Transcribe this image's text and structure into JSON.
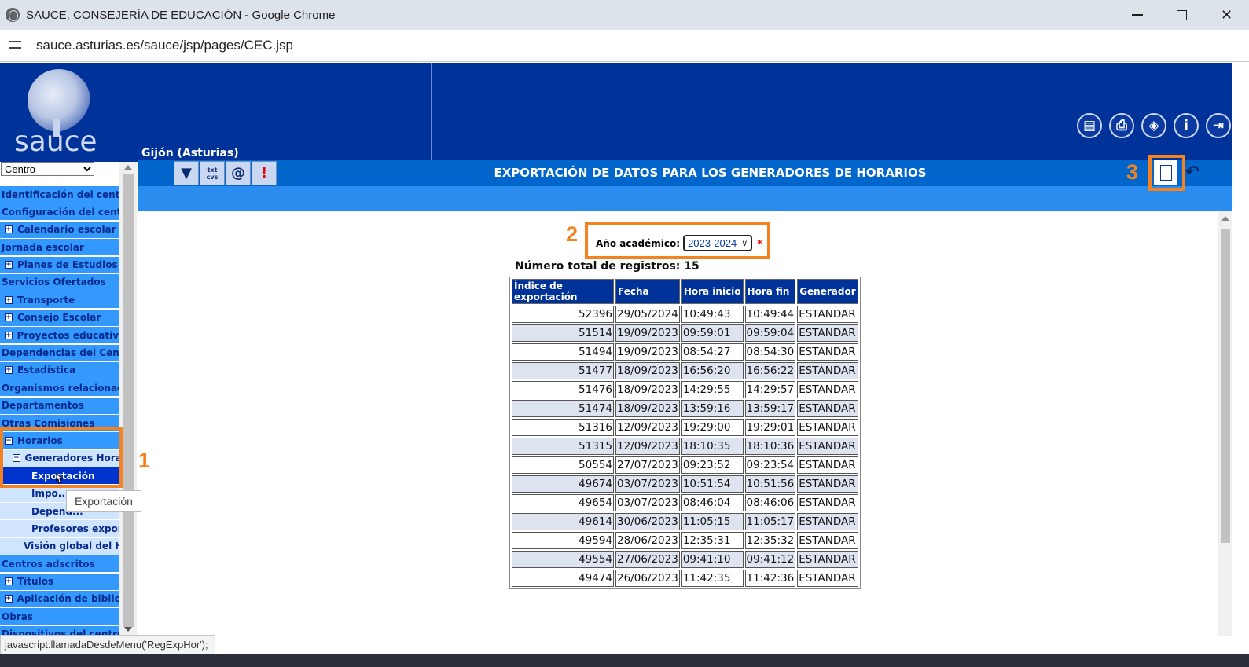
{
  "browser": {
    "title": "SAUCE, CONSEJERÍA DE EDUCACIÓN - Google Chrome",
    "url": "sauce.asturias.es/sauce/jsp/pages/CEC.jsp",
    "minimize": "",
    "maximize": "",
    "close": "✕",
    "status": "javascript:llamadaDesdeMenu('RegExpHor');"
  },
  "header": {
    "logo_text": "sauce",
    "location": "Gijón (Asturias)",
    "tools": [
      "manual-icon",
      "print-icon",
      "navigate-icon",
      "info-icon",
      "exit-icon"
    ],
    "info_glyph": "i"
  },
  "sidebar": {
    "selector_value": "Centro",
    "items": [
      {
        "label": "Identificación del centro",
        "type": "top"
      },
      {
        "label": "Configuración del centro",
        "type": "top"
      },
      {
        "label": "Calendario escolar",
        "type": "expand"
      },
      {
        "label": "Jornada escolar",
        "type": "top"
      },
      {
        "label": "Planes de Estudios",
        "type": "expand"
      },
      {
        "label": "Servicios Ofertados",
        "type": "top"
      },
      {
        "label": "Transporte",
        "type": "expand"
      },
      {
        "label": "Consejo Escolar",
        "type": "expand"
      },
      {
        "label": "Proyectos educativos",
        "type": "expand"
      },
      {
        "label": "Dependencias del Centro",
        "type": "top"
      },
      {
        "label": "Estadística",
        "type": "expand"
      },
      {
        "label": "Organismos relacionados",
        "type": "top"
      },
      {
        "label": "Departamentos",
        "type": "top"
      },
      {
        "label": "Otras Comisiones",
        "type": "top"
      },
      {
        "label": "Horarios",
        "type": "collapse"
      },
      {
        "label": "Generadores Horarios",
        "type": "collapse-sub"
      },
      {
        "label": "Exportación",
        "type": "active"
      },
      {
        "label": "Impo...",
        "type": "leaf"
      },
      {
        "label": "Depend...",
        "type": "leaf"
      },
      {
        "label": "Profesores exportados",
        "type": "leaf"
      },
      {
        "label": "Visión global del Horario",
        "type": "leaf2"
      },
      {
        "label": "Centros adscritos",
        "type": "top"
      },
      {
        "label": "Títulos",
        "type": "expand"
      },
      {
        "label": "Aplicación de bibliotecas",
        "type": "expand"
      },
      {
        "label": "Obras",
        "type": "top"
      },
      {
        "label": "Dispositivos del centro",
        "type": "top"
      }
    ],
    "tooltip": "Exportación"
  },
  "toolbar": {
    "page_title": "EXPORTACIÓN DE DATOS PARA LOS GENERADORES DE HORARIOS",
    "left_buttons": [
      "filter-icon",
      "export-txt-csv-icon",
      "email-icon",
      "alert-icon"
    ],
    "txt_label": "txt",
    "csv_label": "cvs",
    "right_buttons": [
      "new-document-icon",
      "back-icon"
    ]
  },
  "form": {
    "year_label": "Año académico:",
    "year_value": "2023-2024",
    "required_mark": "*"
  },
  "summary": {
    "label": "Número total de registros:",
    "count": "15"
  },
  "table": {
    "headers": [
      "Índice de exportación",
      "Fecha",
      "Hora inicio",
      "Hora fin",
      "Generador"
    ],
    "rows": [
      [
        "52396",
        "29/05/2024",
        "10:49:43",
        "10:49:44",
        "ESTANDAR"
      ],
      [
        "51514",
        "19/09/2023",
        "09:59:01",
        "09:59:04",
        "ESTANDAR"
      ],
      [
        "51494",
        "19/09/2023",
        "08:54:27",
        "08:54:30",
        "ESTANDAR"
      ],
      [
        "51477",
        "18/09/2023",
        "16:56:20",
        "16:56:22",
        "ESTANDAR"
      ],
      [
        "51476",
        "18/09/2023",
        "14:29:55",
        "14:29:57",
        "ESTANDAR"
      ],
      [
        "51474",
        "18/09/2023",
        "13:59:16",
        "13:59:17",
        "ESTANDAR"
      ],
      [
        "51316",
        "12/09/2023",
        "19:29:00",
        "19:29:01",
        "ESTANDAR"
      ],
      [
        "51315",
        "12/09/2023",
        "18:10:35",
        "18:10:36",
        "ESTANDAR"
      ],
      [
        "50554",
        "27/07/2023",
        "09:23:52",
        "09:23:54",
        "ESTANDAR"
      ],
      [
        "49674",
        "03/07/2023",
        "10:51:54",
        "10:51:56",
        "ESTANDAR"
      ],
      [
        "49654",
        "03/07/2023",
        "08:46:04",
        "08:46:06",
        "ESTANDAR"
      ],
      [
        "49614",
        "30/06/2023",
        "11:05:15",
        "11:05:17",
        "ESTANDAR"
      ],
      [
        "49594",
        "28/06/2023",
        "12:35:31",
        "12:35:32",
        "ESTANDAR"
      ],
      [
        "49554",
        "27/06/2023",
        "09:41:10",
        "09:41:12",
        "ESTANDAR"
      ],
      [
        "49474",
        "26/06/2023",
        "11:42:35",
        "11:42:36",
        "ESTANDAR"
      ]
    ]
  },
  "annotations": {
    "step1": "1",
    "step2": "2",
    "step3": "3",
    "color": "#f58220"
  },
  "colors": {
    "header_bg": "#003399",
    "toolbar_bg": "#0066cc",
    "menu_bg": "#3399ff",
    "active_bg": "#0033cc"
  }
}
